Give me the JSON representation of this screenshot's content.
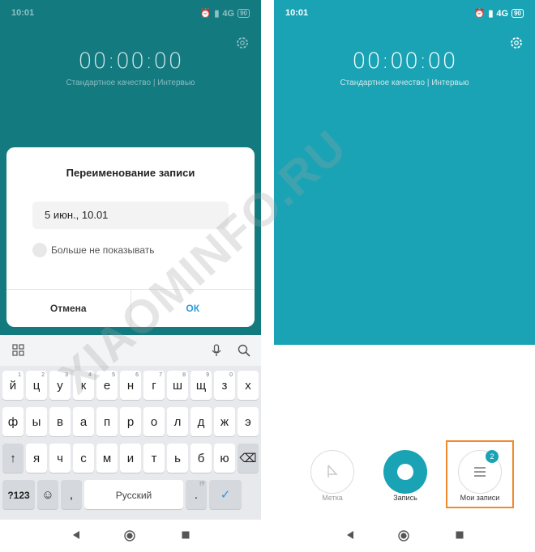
{
  "status_bar": {
    "time": "10:01",
    "network": "4G",
    "battery": "90"
  },
  "recorder": {
    "timer": "00:00:00",
    "quality": "Стандартное качество",
    "mode": "Интервью"
  },
  "dialog": {
    "title": "Переименование записи",
    "input_value": "5 июн., 10.01",
    "checkbox_label": "Больше не показывать",
    "cancel": "Отмена",
    "ok": "ОК"
  },
  "keyboard": {
    "row1": [
      {
        "k": "й",
        "h": "1"
      },
      {
        "k": "ц",
        "h": "2"
      },
      {
        "k": "у",
        "h": "3"
      },
      {
        "k": "к",
        "h": "4"
      },
      {
        "k": "е",
        "h": "5"
      },
      {
        "k": "н",
        "h": "6"
      },
      {
        "k": "г",
        "h": "7"
      },
      {
        "k": "ш",
        "h": "8"
      },
      {
        "k": "щ",
        "h": "9"
      },
      {
        "k": "з",
        "h": "0"
      },
      {
        "k": "х",
        "h": ""
      }
    ],
    "row2": [
      {
        "k": "ф",
        "h": ""
      },
      {
        "k": "ы",
        "h": ""
      },
      {
        "k": "в",
        "h": ""
      },
      {
        "k": "а",
        "h": ""
      },
      {
        "k": "п",
        "h": ""
      },
      {
        "k": "р",
        "h": ""
      },
      {
        "k": "о",
        "h": ""
      },
      {
        "k": "л",
        "h": ""
      },
      {
        "k": "д",
        "h": ""
      },
      {
        "k": "ж",
        "h": ""
      },
      {
        "k": "э",
        "h": ""
      }
    ],
    "row3": [
      {
        "k": "я",
        "h": ""
      },
      {
        "k": "ч",
        "h": ""
      },
      {
        "k": "с",
        "h": ""
      },
      {
        "k": "м",
        "h": ""
      },
      {
        "k": "и",
        "h": ""
      },
      {
        "k": "т",
        "h": ""
      },
      {
        "k": "ь",
        "h": ""
      },
      {
        "k": "б",
        "h": ""
      },
      {
        "k": "ю",
        "h": ""
      }
    ],
    "shift": "↑",
    "backspace": "⌫",
    "symbols": "?123",
    "emoji": "☺",
    "comma": ",",
    "space": "Русский",
    "period": ".",
    "period_hint": "!?",
    "enter": "✓",
    "icons": [
      "grid-icon",
      "microphone-icon",
      "search-icon"
    ]
  },
  "controls": {
    "mark": "Метка",
    "record": "Запись",
    "my_records": "Мои записи",
    "my_records_count": "2"
  },
  "watermark": "XIAOMINFO.RU",
  "colors": {
    "teal_dark": "#137a80",
    "teal": "#1aa3b4",
    "accent_blue": "#2d9ad8",
    "highlight": "#f08a2c"
  }
}
